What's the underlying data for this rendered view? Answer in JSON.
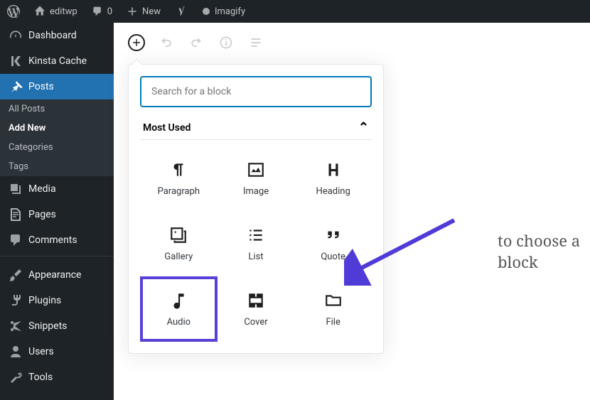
{
  "topbar": {
    "site_name": "editwp",
    "comments_count": "0",
    "new_label": "New",
    "imagify_label": "Imagify"
  },
  "sidebar": {
    "dashboard": "Dashboard",
    "kinsta": "Kinsta Cache",
    "posts": "Posts",
    "posts_sub": {
      "all": "All Posts",
      "add_new": "Add New",
      "categories": "Categories",
      "tags": "Tags"
    },
    "media": "Media",
    "pages": "Pages",
    "comments": "Comments",
    "appearance": "Appearance",
    "plugins": "Plugins",
    "snippets": "Snippets",
    "users": "Users",
    "tools": "Tools"
  },
  "inserter": {
    "search_placeholder": "Search for a block",
    "section_title": "Most Used",
    "blocks": {
      "paragraph": "Paragraph",
      "image": "Image",
      "heading": "Heading",
      "gallery": "Gallery",
      "list": "List",
      "quote": "Quote",
      "audio": "Audio",
      "cover": "Cover",
      "file": "File"
    }
  },
  "editor": {
    "hint_fragment": "to choose a block"
  }
}
